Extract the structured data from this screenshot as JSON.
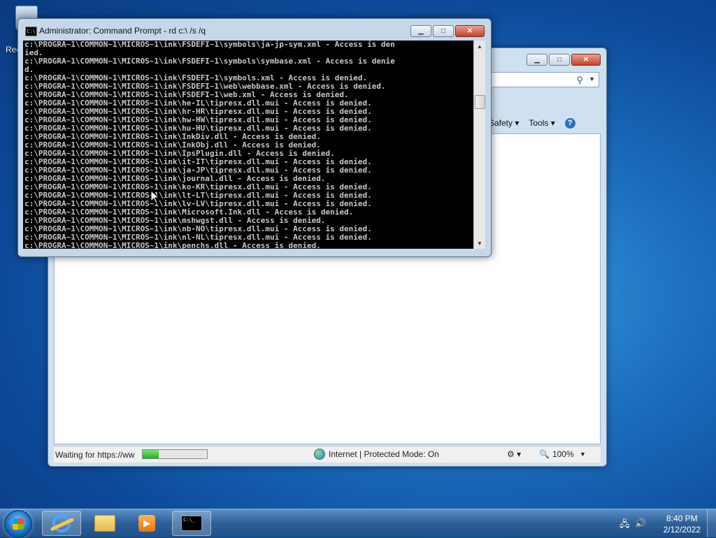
{
  "desktop": {
    "recycle_bin_label": "Rec"
  },
  "ie": {
    "command_bar": {
      "safety": "Safety ▾",
      "tools": "Tools ▾",
      "help": "?"
    },
    "status": {
      "text": "Waiting for https://ww",
      "progress_fraction": 0.25,
      "zone": "Internet | Protected Mode: On",
      "zoom": "100%"
    }
  },
  "cmd": {
    "title": "Administrator: Command Prompt - rd  c:\\ /s /q",
    "output": "c:\\PROGRA~1\\COMMON~1\\MICROS~1\\ink\\FSDEFI~1\\symbols\\ja-jp-sym.xml - Access is den\nied.\nc:\\PROGRA~1\\COMMON~1\\MICROS~1\\ink\\FSDEFI~1\\symbols\\symbase.xml - Access is denie\nd.\nc:\\PROGRA~1\\COMMON~1\\MICROS~1\\ink\\FSDEFI~1\\symbols.xml - Access is denied.\nc:\\PROGRA~1\\COMMON~1\\MICROS~1\\ink\\FSDEFI~1\\web\\webbase.xml - Access is denied.\nc:\\PROGRA~1\\COMMON~1\\MICROS~1\\ink\\FSDEFI~1\\web.xml - Access is denied.\nc:\\PROGRA~1\\COMMON~1\\MICROS~1\\ink\\he-IL\\tipresx.dll.mui - Access is denied.\nc:\\PROGRA~1\\COMMON~1\\MICROS~1\\ink\\hr-HR\\tipresx.dll.mui - Access is denied.\nc:\\PROGRA~1\\COMMON~1\\MICROS~1\\ink\\hw-HW\\tipresx.dll.mui - Access is denied.\nc:\\PROGRA~1\\COMMON~1\\MICROS~1\\ink\\hu-HU\\tipresx.dll.mui - Access is denied.\nc:\\PROGRA~1\\COMMON~1\\MICROS~1\\ink\\InkDiv.dll - Access is denied.\nc:\\PROGRA~1\\COMMON~1\\MICROS~1\\ink\\InkObj.dll - Access is denied.\nc:\\PROGRA~1\\COMMON~1\\MICROS~1\\ink\\IpsPlugin.dll - Access is denied.\nc:\\PROGRA~1\\COMMON~1\\MICROS~1\\ink\\it-IT\\tipresx.dll.mui - Access is denied.\nc:\\PROGRA~1\\COMMON~1\\MICROS~1\\ink\\ja-JP\\tipresx.dll.mui - Access is denied.\nc:\\PROGRA~1\\COMMON~1\\MICROS~1\\ink\\journal.dll - Access is denied.\nc:\\PROGRA~1\\COMMON~1\\MICROS~1\\ink\\ko-KR\\tipresx.dll.mui - Access is denied.\nc:\\PROGRA~1\\COMMON~1\\MICROS~1\\ink\\lt-LT\\tipresx.dll.mui - Access is denied.\nc:\\PROGRA~1\\COMMON~1\\MICROS~1\\ink\\lv-LV\\tipresx.dll.mui - Access is denied.\nc:\\PROGRA~1\\COMMON~1\\MICROS~1\\ink\\Microsoft.Ink.dll - Access is denied.\nc:\\PROGRA~1\\COMMON~1\\MICROS~1\\ink\\mshwgst.dll - Access is denied.\nc:\\PROGRA~1\\COMMON~1\\MICROS~1\\ink\\nb-NO\\tipresx.dll.mui - Access is denied.\nc:\\PROGRA~1\\COMMON~1\\MICROS~1\\ink\\nl-NL\\tipresx.dll.mui - Access is denied.\nc:\\PROGRA~1\\COMMON~1\\MICROS~1\\ink\\penchs.dll - Access is denied."
  },
  "taskbar": {
    "clock_time": "8:40 PM",
    "clock_date": "2/12/2022"
  },
  "colors": {
    "console_bg": "#000000",
    "console_fg": "#c8c8c8",
    "close_button": "#c6422b"
  }
}
